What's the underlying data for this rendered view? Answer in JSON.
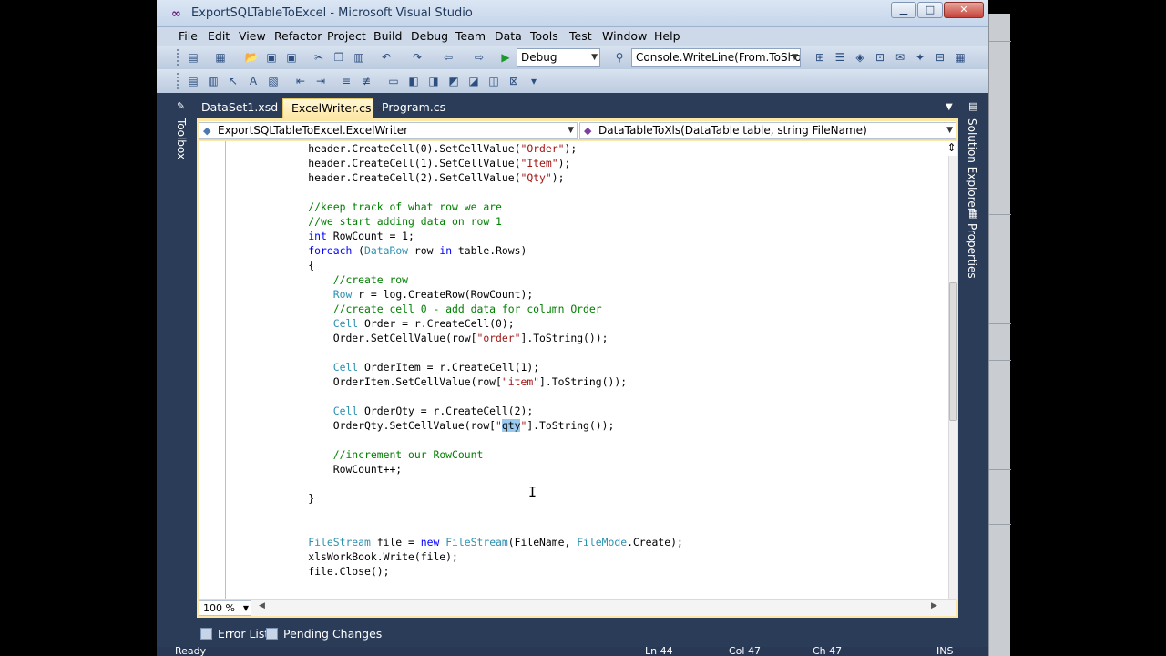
{
  "window": {
    "title": "ExportSQLTableToExcel - Microsoft Visual Studio"
  },
  "menu": [
    "File",
    "Edit",
    "View",
    "Refactor",
    "Project",
    "Build",
    "Debug",
    "Team",
    "Data",
    "Tools",
    "Test",
    "Window",
    "Help"
  ],
  "toolbar": {
    "config": "Debug",
    "find_combo": "Console.WriteLine(From.ToShor"
  },
  "tabs": [
    {
      "label": "DataSet1.xsd",
      "active": false
    },
    {
      "label": "ExcelWriter.cs",
      "active": true
    },
    {
      "label": "Program.cs",
      "active": false
    }
  ],
  "side": {
    "toolbox": "Toolbox",
    "solution_explorer": "Solution Explorer",
    "properties": "Properties"
  },
  "navbar": {
    "type": "ExportSQLTableToExcel.ExcelWriter",
    "member": "DataTableToXls(DataTable table, string FileName)"
  },
  "code_lines": [
    [
      [
        "",
        "header.CreateCell(0).SetCellValue("
      ],
      [
        "st",
        "\"Order\""
      ],
      [
        "",
        ");"
      ]
    ],
    [
      [
        "",
        "header.CreateCell(1).SetCellValue("
      ],
      [
        "st",
        "\"Item\""
      ],
      [
        "",
        ");"
      ]
    ],
    [
      [
        "",
        "header.CreateCell(2).SetCellValue("
      ],
      [
        "st",
        "\"Qty\""
      ],
      [
        "",
        ");"
      ]
    ],
    [],
    [
      [
        "cm",
        "//keep track of what row we are"
      ]
    ],
    [
      [
        "cm",
        "//we start adding data on row 1"
      ]
    ],
    [
      [
        "kw",
        "int"
      ],
      [
        "",
        " RowCount = 1;"
      ]
    ],
    [
      [
        "kw",
        "foreach"
      ],
      [
        "",
        " ("
      ],
      [
        "ty",
        "DataRow"
      ],
      [
        "",
        " row "
      ],
      [
        "kw",
        "in"
      ],
      [
        "",
        " table.Rows)"
      ]
    ],
    [
      [
        "",
        "{"
      ]
    ],
    [
      [
        "",
        "    "
      ],
      [
        "cm",
        "//create row"
      ]
    ],
    [
      [
        "",
        "    "
      ],
      [
        "ty",
        "Row"
      ],
      [
        "",
        " r = log.CreateRow(RowCount);"
      ]
    ],
    [
      [
        "",
        "    "
      ],
      [
        "cm",
        "//create cell 0 - add data for column Order"
      ]
    ],
    [
      [
        "",
        "    "
      ],
      [
        "ty",
        "Cell"
      ],
      [
        "",
        " Order = r.CreateCell(0);"
      ]
    ],
    [
      [
        "",
        "    Order.SetCellValue(row["
      ],
      [
        "st",
        "\"order\""
      ],
      [
        "",
        "].ToString());"
      ]
    ],
    [],
    [
      [
        "",
        "    "
      ],
      [
        "ty",
        "Cell"
      ],
      [
        "",
        " OrderItem = r.CreateCell(1);"
      ]
    ],
    [
      [
        "",
        "    OrderItem.SetCellValue(row["
      ],
      [
        "st",
        "\"item\""
      ],
      [
        "",
        "].ToString());"
      ]
    ],
    [],
    [
      [
        "",
        "    "
      ],
      [
        "ty",
        "Cell"
      ],
      [
        "",
        " OrderQty = r.CreateCell(2);"
      ]
    ],
    [
      [
        "",
        "    OrderQty.SetCellValue(row["
      ],
      [
        "st",
        "\""
      ],
      [
        "sel",
        "qty"
      ],
      [
        "st",
        "\""
      ],
      [
        "",
        "].ToString());"
      ]
    ],
    [],
    [
      [
        "",
        "    "
      ],
      [
        "cm",
        "//increment our RowCount"
      ]
    ],
    [
      [
        "",
        "    RowCount++;"
      ]
    ],
    [],
    [
      [
        "",
        "}"
      ]
    ],
    [],
    [],
    [
      [
        "ty",
        "FileStream"
      ],
      [
        "",
        " file = "
      ],
      [
        "kw",
        "new"
      ],
      [
        "",
        " "
      ],
      [
        "ty",
        "FileStream"
      ],
      [
        "",
        "(FileName, "
      ],
      [
        "ty",
        "FileMode"
      ],
      [
        "",
        ".Create);"
      ]
    ],
    [
      [
        "",
        "xlsWorkBook.Write(file);"
      ]
    ],
    [
      [
        "",
        "file.Close();"
      ]
    ]
  ],
  "zoom": "100 %",
  "bottom_tabs": [
    "Error List",
    "Pending Changes"
  ],
  "status": {
    "ready": "Ready",
    "ln": "Ln 44",
    "col": "Col 47",
    "ch": "Ch 47",
    "ins": "INS"
  }
}
